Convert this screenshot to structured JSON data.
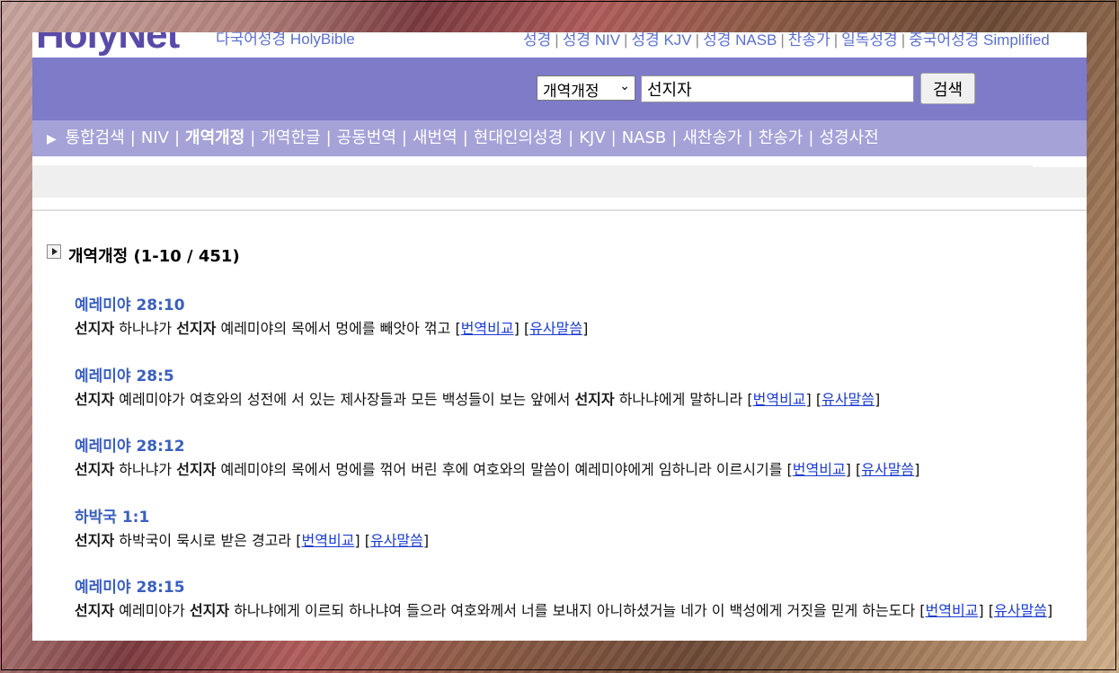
{
  "header": {
    "logo": "HolyNet",
    "subtitle": "다국어성경 HolyBible",
    "top_links": [
      "성경",
      "성경 NIV",
      "성경 KJV",
      "성경 NASB",
      "찬송가",
      "일독성경",
      "중국어성경 Simplified"
    ]
  },
  "search": {
    "version_selected": "개역개정",
    "query": "선지자",
    "button_label": "검색"
  },
  "nav": {
    "items": [
      {
        "label": "통합검색",
        "active": false
      },
      {
        "label": "NIV",
        "active": false
      },
      {
        "label": "개역개정",
        "active": true
      },
      {
        "label": "개역한글",
        "active": false
      },
      {
        "label": "공동번역",
        "active": false
      },
      {
        "label": "새번역",
        "active": false
      },
      {
        "label": "현대인의성경",
        "active": false
      },
      {
        "label": "KJV",
        "active": false
      },
      {
        "label": "NASB",
        "active": false
      },
      {
        "label": "새찬송가",
        "active": false
      },
      {
        "label": "찬송가",
        "active": false
      },
      {
        "label": "성경사전",
        "active": false
      }
    ]
  },
  "results": {
    "heading": "개역개정 (1-10 / 451)",
    "compare_label": "번역비교",
    "similar_label": "유사말씀",
    "items": [
      {
        "ref": "예레미야 28:10",
        "parts": [
          [
            "선지자",
            true
          ],
          [
            " 하나냐가 ",
            false
          ],
          [
            "선지자",
            true
          ],
          [
            " 예레미야의 목에서 멍에를 빼앗아 꺾고 ",
            false
          ]
        ]
      },
      {
        "ref": "예레미야 28:5",
        "parts": [
          [
            "선지자",
            true
          ],
          [
            " 예레미야가 여호와의 성전에 서 있는 제사장들과 모든 백성들이 보는 앞에서 ",
            false
          ],
          [
            "선지자",
            true
          ],
          [
            " 하나냐에게 말하니라 ",
            false
          ]
        ]
      },
      {
        "ref": "예레미야 28:12",
        "parts": [
          [
            "선지자",
            true
          ],
          [
            " 하나냐가 ",
            false
          ],
          [
            "선지자",
            true
          ],
          [
            " 예레미야의 목에서 멍에를 꺾어 버린 후에 여호와의 말씀이 예레미야에게 임하니라 이르시기를 ",
            false
          ]
        ]
      },
      {
        "ref": "하박국 1:1",
        "parts": [
          [
            "선지자",
            true
          ],
          [
            " 하박국이 묵시로 받은 경고라 ",
            false
          ]
        ]
      },
      {
        "ref": "예레미야 28:15",
        "parts": [
          [
            "선지자",
            true
          ],
          [
            " 예레미야가 ",
            false
          ],
          [
            "선지자",
            true
          ],
          [
            " 하나냐에게 이르되 하나냐여 들으라 여호와께서 너를 보내지 아니하셨거늘 네가 이 백성에게 거짓을 믿게 하는도다 ",
            false
          ]
        ]
      }
    ]
  }
}
